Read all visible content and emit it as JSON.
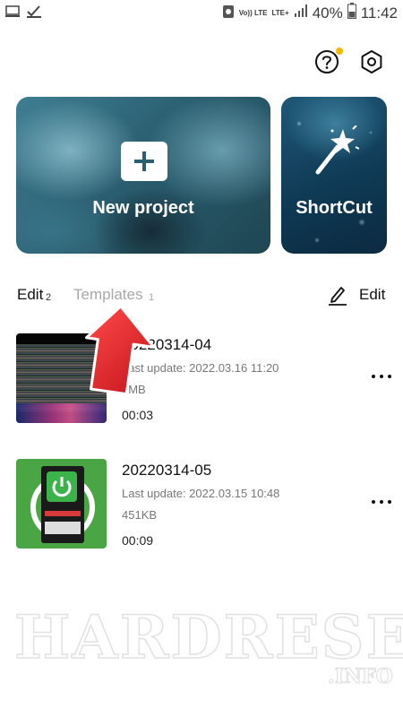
{
  "status_bar": {
    "network_label": "Vo)) LTE",
    "lte_label": "LTE+",
    "battery": "40%",
    "time": "11:42"
  },
  "top_actions": {
    "help_icon": "question-circle-icon",
    "settings_icon": "hexagon-settings-icon",
    "notification_dot_color": "#f5b800"
  },
  "cards": {
    "new_project": {
      "label": "New project",
      "icon": "plus-icon"
    },
    "shortcut": {
      "label": "ShortCut",
      "icon": "magic-wand-icon"
    }
  },
  "tabs": {
    "edit": {
      "label": "Edit",
      "count": "2"
    },
    "templates": {
      "label": "Templates",
      "count": "1"
    }
  },
  "edit_action": {
    "label": "Edit",
    "icon": "pencil-icon"
  },
  "projects": [
    {
      "name": "20220314-04",
      "last_update": "Last update: 2022.03.16 11:20",
      "size": "4MB",
      "duration": "00:03"
    },
    {
      "name": "20220314-05",
      "last_update": "Last update: 2022.03.15 10:48",
      "size": "451KB",
      "duration": "00:09"
    }
  ],
  "watermark": {
    "text": "HARDRESET",
    "sub": ".INFO"
  }
}
